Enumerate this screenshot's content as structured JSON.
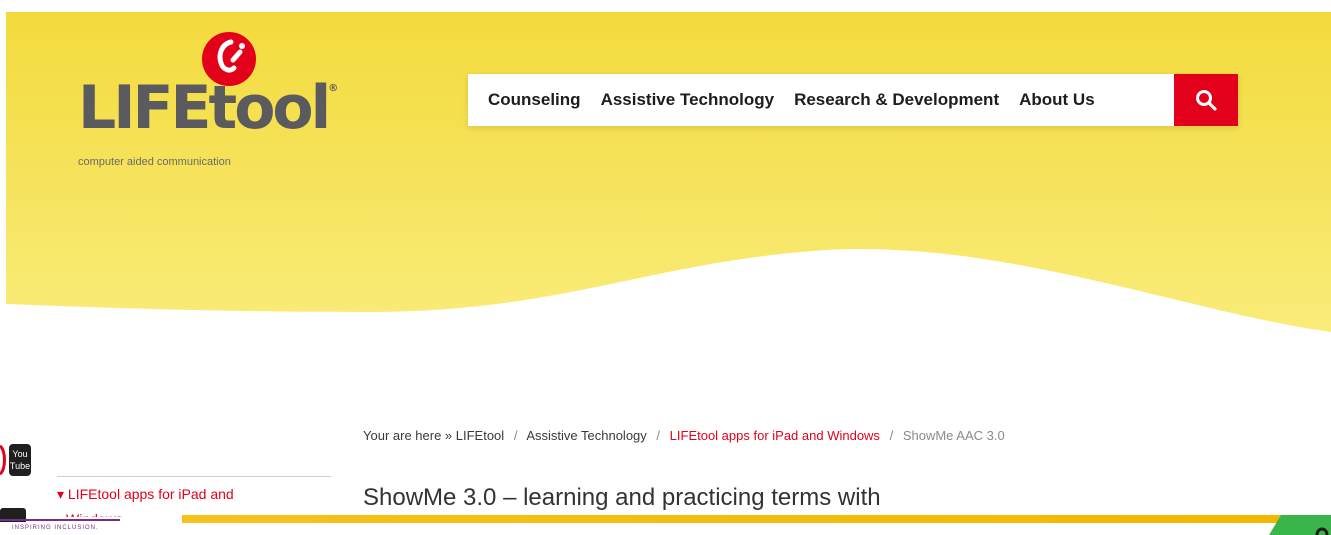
{
  "brand": {
    "logo_text": "LIFEtool",
    "registered_mark": "®",
    "tagline": "computer aided communication",
    "colors": {
      "accent": "#e3001b",
      "logo_gray": "#5b5b5f",
      "hero_yellow": "#f4df4a"
    }
  },
  "nav": {
    "items": [
      {
        "label": "Counseling"
      },
      {
        "label": "Assistive Technology"
      },
      {
        "label": "Research & Development"
      },
      {
        "label": "About Us"
      }
    ],
    "search_icon": "search-icon"
  },
  "breadcrumb": {
    "prefix": "Your are here »",
    "items": [
      {
        "label": "LIFEtool"
      },
      {
        "label": "Assistive Technology"
      },
      {
        "label": "LIFEtool apps for iPad and Windows"
      },
      {
        "label": "ShowMe AAC 3.0"
      }
    ],
    "separator": "/"
  },
  "page": {
    "title": "ShowMe 3.0 – learning and practicing terms with"
  },
  "sidebar": {
    "active_item": "▾ LIFEtool apps for iPad and",
    "active_item_cont": "Windows"
  },
  "social": {
    "youtube_label_1": "You",
    "youtube_label_2": "Tube"
  },
  "footer_fragment": {
    "inspiring_text": "INSPIRING INCLUSION."
  }
}
